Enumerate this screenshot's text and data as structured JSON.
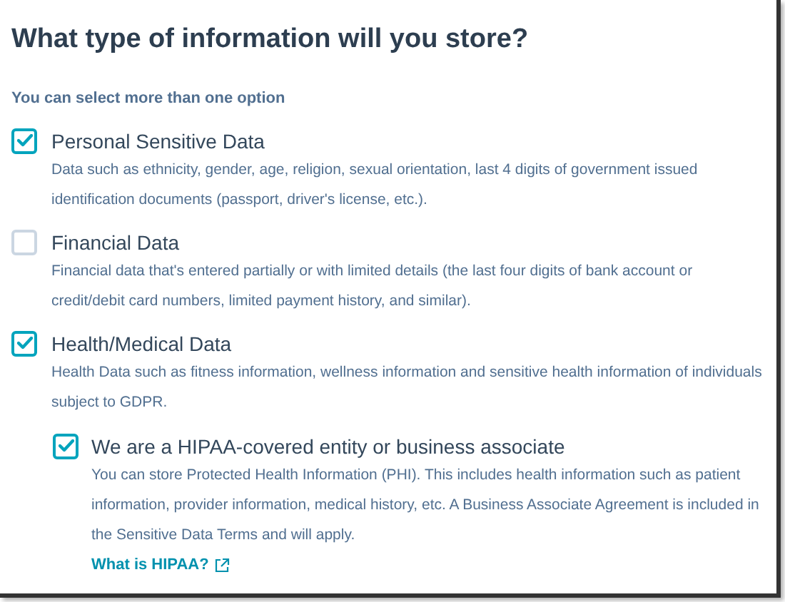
{
  "title": "What type of information will you store?",
  "hint": "You can select more than one option",
  "options": [
    {
      "label": "Personal Sensitive Data",
      "checked": true,
      "description": "Data such as ethnicity, gender, age, religion, sexual orientation, last 4 digits of government issued identification documents (passport, driver's license, etc.)."
    },
    {
      "label": "Financial Data",
      "checked": false,
      "description": "Financial data that's entered partially or with limited details (the last four digits of bank account or credit/debit card numbers, limited payment history, and similar)."
    },
    {
      "label": "Health/Medical Data",
      "checked": true,
      "description": "Health Data such as fitness information, wellness information and sensitive health information of individuals subject to GDPR.",
      "children": [
        {
          "label": "We are a HIPAA-covered entity or business associate",
          "checked": true,
          "description": "You can store Protected Health Information (PHI). This includes health information such as patient information, provider information, medical history, etc. A Business Associate Agreement is included in the Sensitive Data Terms and will apply.",
          "link": "What is HIPAA?"
        }
      ]
    }
  ]
}
